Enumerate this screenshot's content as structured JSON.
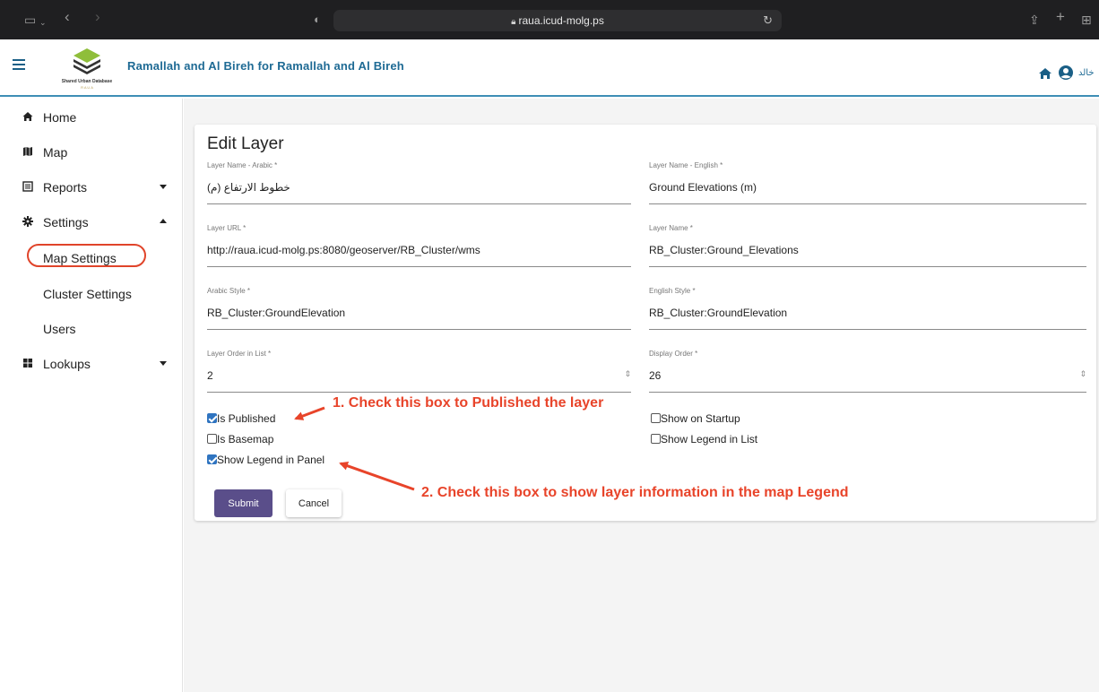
{
  "browser": {
    "url": "raua.icud-molg.ps"
  },
  "header": {
    "title": "Ramallah and Al Bireh for Ramallah and Al Bireh",
    "logo_text": "Shared Urban Database",
    "logo_sub": "R A U A",
    "user_name": "خالد",
    "accent_color": "#1e6a94"
  },
  "sidebar": {
    "items": [
      {
        "label": "Home",
        "icon": "home-icon"
      },
      {
        "label": "Map",
        "icon": "map-icon"
      },
      {
        "label": "Reports",
        "icon": "reports-icon"
      },
      {
        "label": "Settings",
        "icon": "gear-icon"
      },
      {
        "label": "Map Settings"
      },
      {
        "label": "Cluster Settings"
      },
      {
        "label": "Users"
      },
      {
        "label": "Lookups",
        "icon": "lookups-icon"
      }
    ]
  },
  "form": {
    "title": "Edit Layer",
    "fields": {
      "layer_name_arabic": {
        "label": "Layer Name - Arabic *",
        "value": "(خطوط الارتفاع (م"
      },
      "layer_name_english": {
        "label": "Layer Name - English *",
        "value": "Ground Elevations (m)"
      },
      "layer_url": {
        "label": "Layer URL *",
        "value": "http://raua.icud-molg.ps:8080/geoserver/RB_Cluster/wms"
      },
      "layer_name": {
        "label": "Layer Name *",
        "value": "RB_Cluster:Ground_Elevations"
      },
      "arabic_style": {
        "label": "Arabic Style *",
        "value": "RB_Cluster:GroundElevation"
      },
      "english_style": {
        "label": "English Style *",
        "value": "RB_Cluster:GroundElevation"
      },
      "layer_order": {
        "label": "Layer Order in List *",
        "value": "2"
      },
      "display_order": {
        "label": "Display Order *",
        "value": "26"
      }
    },
    "checkboxes": {
      "is_published": {
        "label": "Is Published",
        "checked": true
      },
      "is_basemap": {
        "label": "Is Basemap",
        "checked": false
      },
      "show_legend_panel": {
        "label": "Show Legend in Panel",
        "checked": true
      },
      "show_on_startup": {
        "label": "Show on Startup",
        "checked": false
      },
      "show_legend_list": {
        "label": "Show Legend in List",
        "checked": false
      }
    },
    "submit_label": "Submit",
    "cancel_label": "Cancel"
  },
  "annotations": {
    "note1": "1. Check this box to Published the layer",
    "note2": "2. Check this box to show layer information in the map Legend"
  }
}
